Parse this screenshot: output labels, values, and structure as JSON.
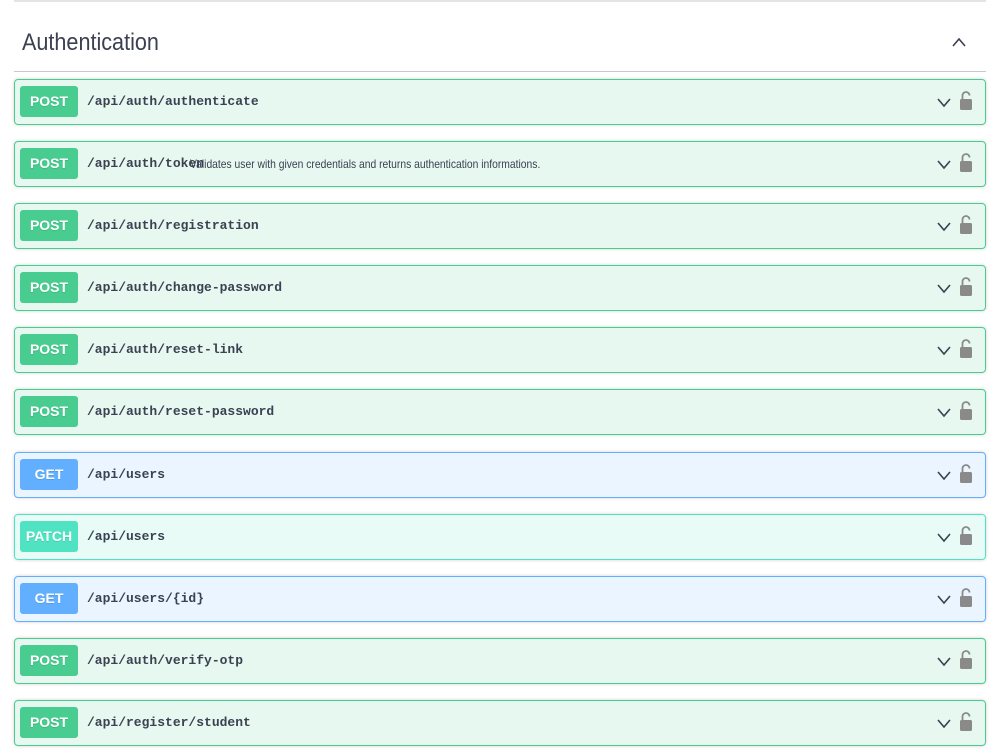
{
  "section": {
    "title": "Authentication",
    "collapse_icon": "chevron-up-icon"
  },
  "operations": [
    {
      "method": "POST",
      "path": "/api/auth/authenticate",
      "summary": ""
    },
    {
      "method": "POST",
      "path": "/api/auth/token",
      "summary": "Validates user with given credentials and returns authentication informations."
    },
    {
      "method": "POST",
      "path": "/api/auth/registration",
      "summary": ""
    },
    {
      "method": "POST",
      "path": "/api/auth/change-password",
      "summary": ""
    },
    {
      "method": "POST",
      "path": "/api/auth/reset-link",
      "summary": ""
    },
    {
      "method": "POST",
      "path": "/api/auth/reset-password",
      "summary": ""
    },
    {
      "method": "GET",
      "path": "/api/users",
      "summary": ""
    },
    {
      "method": "PATCH",
      "path": "/api/users",
      "summary": ""
    },
    {
      "method": "GET",
      "path": "/api/users/{id}",
      "summary": ""
    },
    {
      "method": "POST",
      "path": "/api/auth/verify-otp",
      "summary": ""
    },
    {
      "method": "POST",
      "path": "/api/register/student",
      "summary": ""
    }
  ],
  "icons": {
    "expand": "chevron-down-icon",
    "auth": "lock-icon"
  },
  "colors": {
    "post": "#49cc90",
    "get": "#61affe",
    "patch": "#50e3c2",
    "text": "#3b4151"
  }
}
